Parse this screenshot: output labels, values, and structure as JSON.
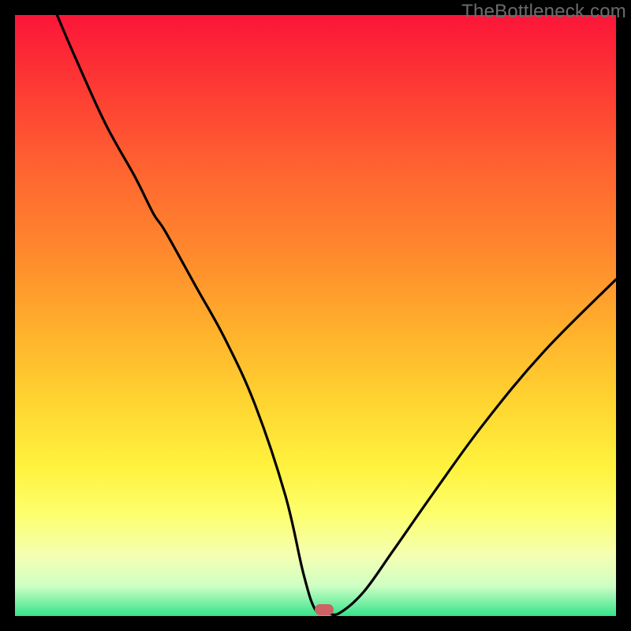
{
  "watermark": "TheBottleneck.com",
  "marker": {
    "x_pct": 51.5,
    "y_pct": 99.0
  },
  "chart_data": {
    "type": "line",
    "title": "",
    "xlabel": "",
    "ylabel": "",
    "xlim": [
      0,
      100
    ],
    "ylim": [
      0,
      100
    ],
    "grid": false,
    "series": [
      {
        "name": "bottleneck-curve",
        "x": [
          7,
          10,
          15,
          20,
          23,
          25,
          30,
          35,
          40,
          45,
          48,
          50,
          52,
          54,
          58,
          63,
          70,
          78,
          88,
          100
        ],
        "y": [
          100,
          93,
          82,
          73,
          67,
          64,
          55,
          46,
          35,
          20,
          7,
          1,
          0.5,
          0.5,
          4,
          11,
          21,
          32,
          44,
          56
        ]
      }
    ],
    "annotations": [
      {
        "type": "marker",
        "x": 51.5,
        "y": 1.0,
        "label": "optimal-point"
      }
    ],
    "background_gradient": {
      "top": "#fb1538",
      "bottom": "#35e38b"
    }
  }
}
